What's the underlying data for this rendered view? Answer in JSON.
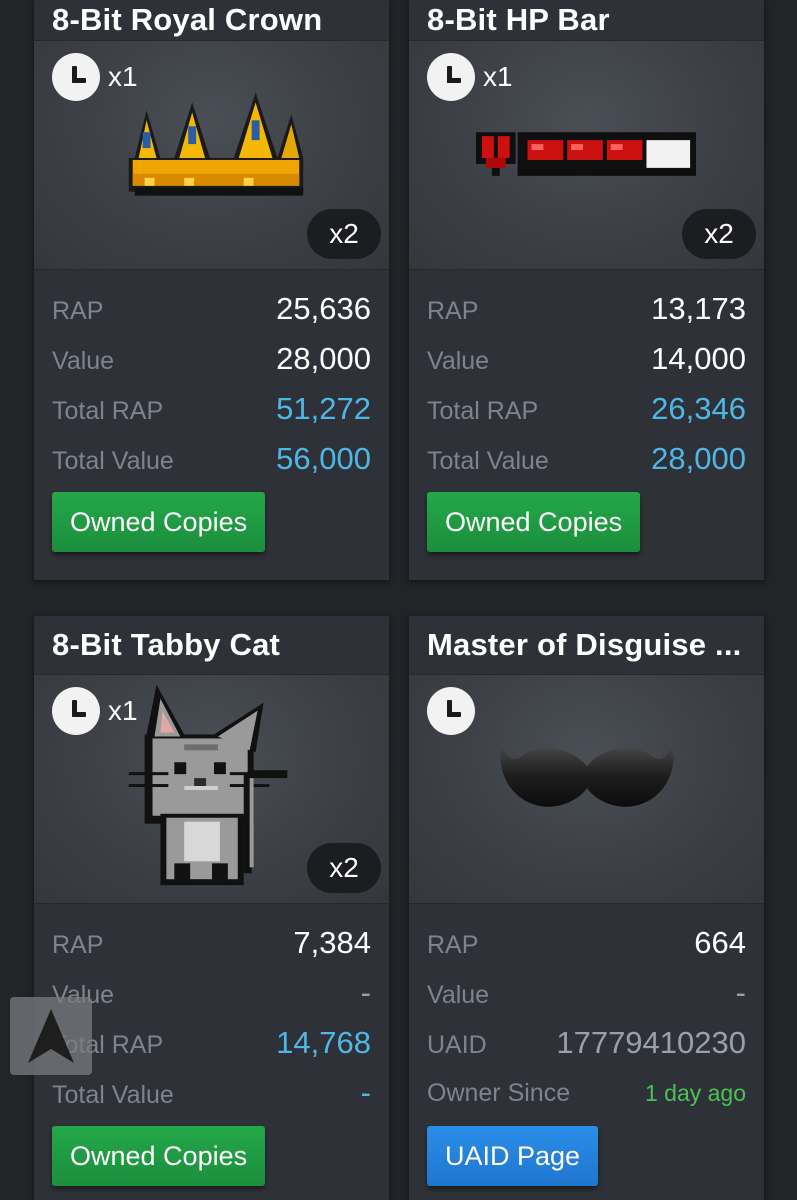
{
  "cards": [
    {
      "title": "8-Bit Royal Crown",
      "badge_copies": "x1",
      "owned_count": "x2",
      "stats": [
        {
          "label": "RAP",
          "value": "25,636"
        },
        {
          "label": "Value",
          "value": "28,000"
        },
        {
          "label": "Total RAP",
          "value": "51,272"
        },
        {
          "label": "Total Value",
          "value": "56,000"
        }
      ],
      "button": "Owned Copies",
      "icon": "crown-item-image"
    },
    {
      "title": "8-Bit HP Bar",
      "badge_copies": "x1",
      "owned_count": "x2",
      "stats": [
        {
          "label": "RAP",
          "value": "13,173"
        },
        {
          "label": "Value",
          "value": "14,000"
        },
        {
          "label": "Total RAP",
          "value": "26,346"
        },
        {
          "label": "Total Value",
          "value": "28,000"
        }
      ],
      "button": "Owned Copies",
      "icon": "hp-bar-item-image"
    },
    {
      "title": "8-Bit Tabby Cat",
      "badge_copies": "x1",
      "owned_count": "x2",
      "stats": [
        {
          "label": "RAP",
          "value": "7,384"
        },
        {
          "label": "Value",
          "value": "-"
        },
        {
          "label": "Total RAP",
          "value": "14,768"
        },
        {
          "label": "Total Value",
          "value": "-"
        }
      ],
      "button": "Owned Copies",
      "icon": "tabby-cat-item-image"
    },
    {
      "title": "Master of Disguise ...",
      "stats": [
        {
          "label": "RAP",
          "value": "664"
        },
        {
          "label": "Value",
          "value": "-"
        },
        {
          "label": "UAID",
          "value": "17779410230"
        },
        {
          "label": "Owner Since",
          "value": "1 day ago"
        }
      ],
      "button": "UAID Page",
      "icon": "mustache-item-image"
    }
  ],
  "colors": {
    "background": "#222428",
    "card": "#2e3137",
    "accent_blue": "#4fb7e6",
    "button_green": "#24a849",
    "button_blue": "#2a8ee8",
    "owner_since_green": "#4cc157"
  },
  "overlay": {
    "icon": "navigation-arrow-icon"
  }
}
